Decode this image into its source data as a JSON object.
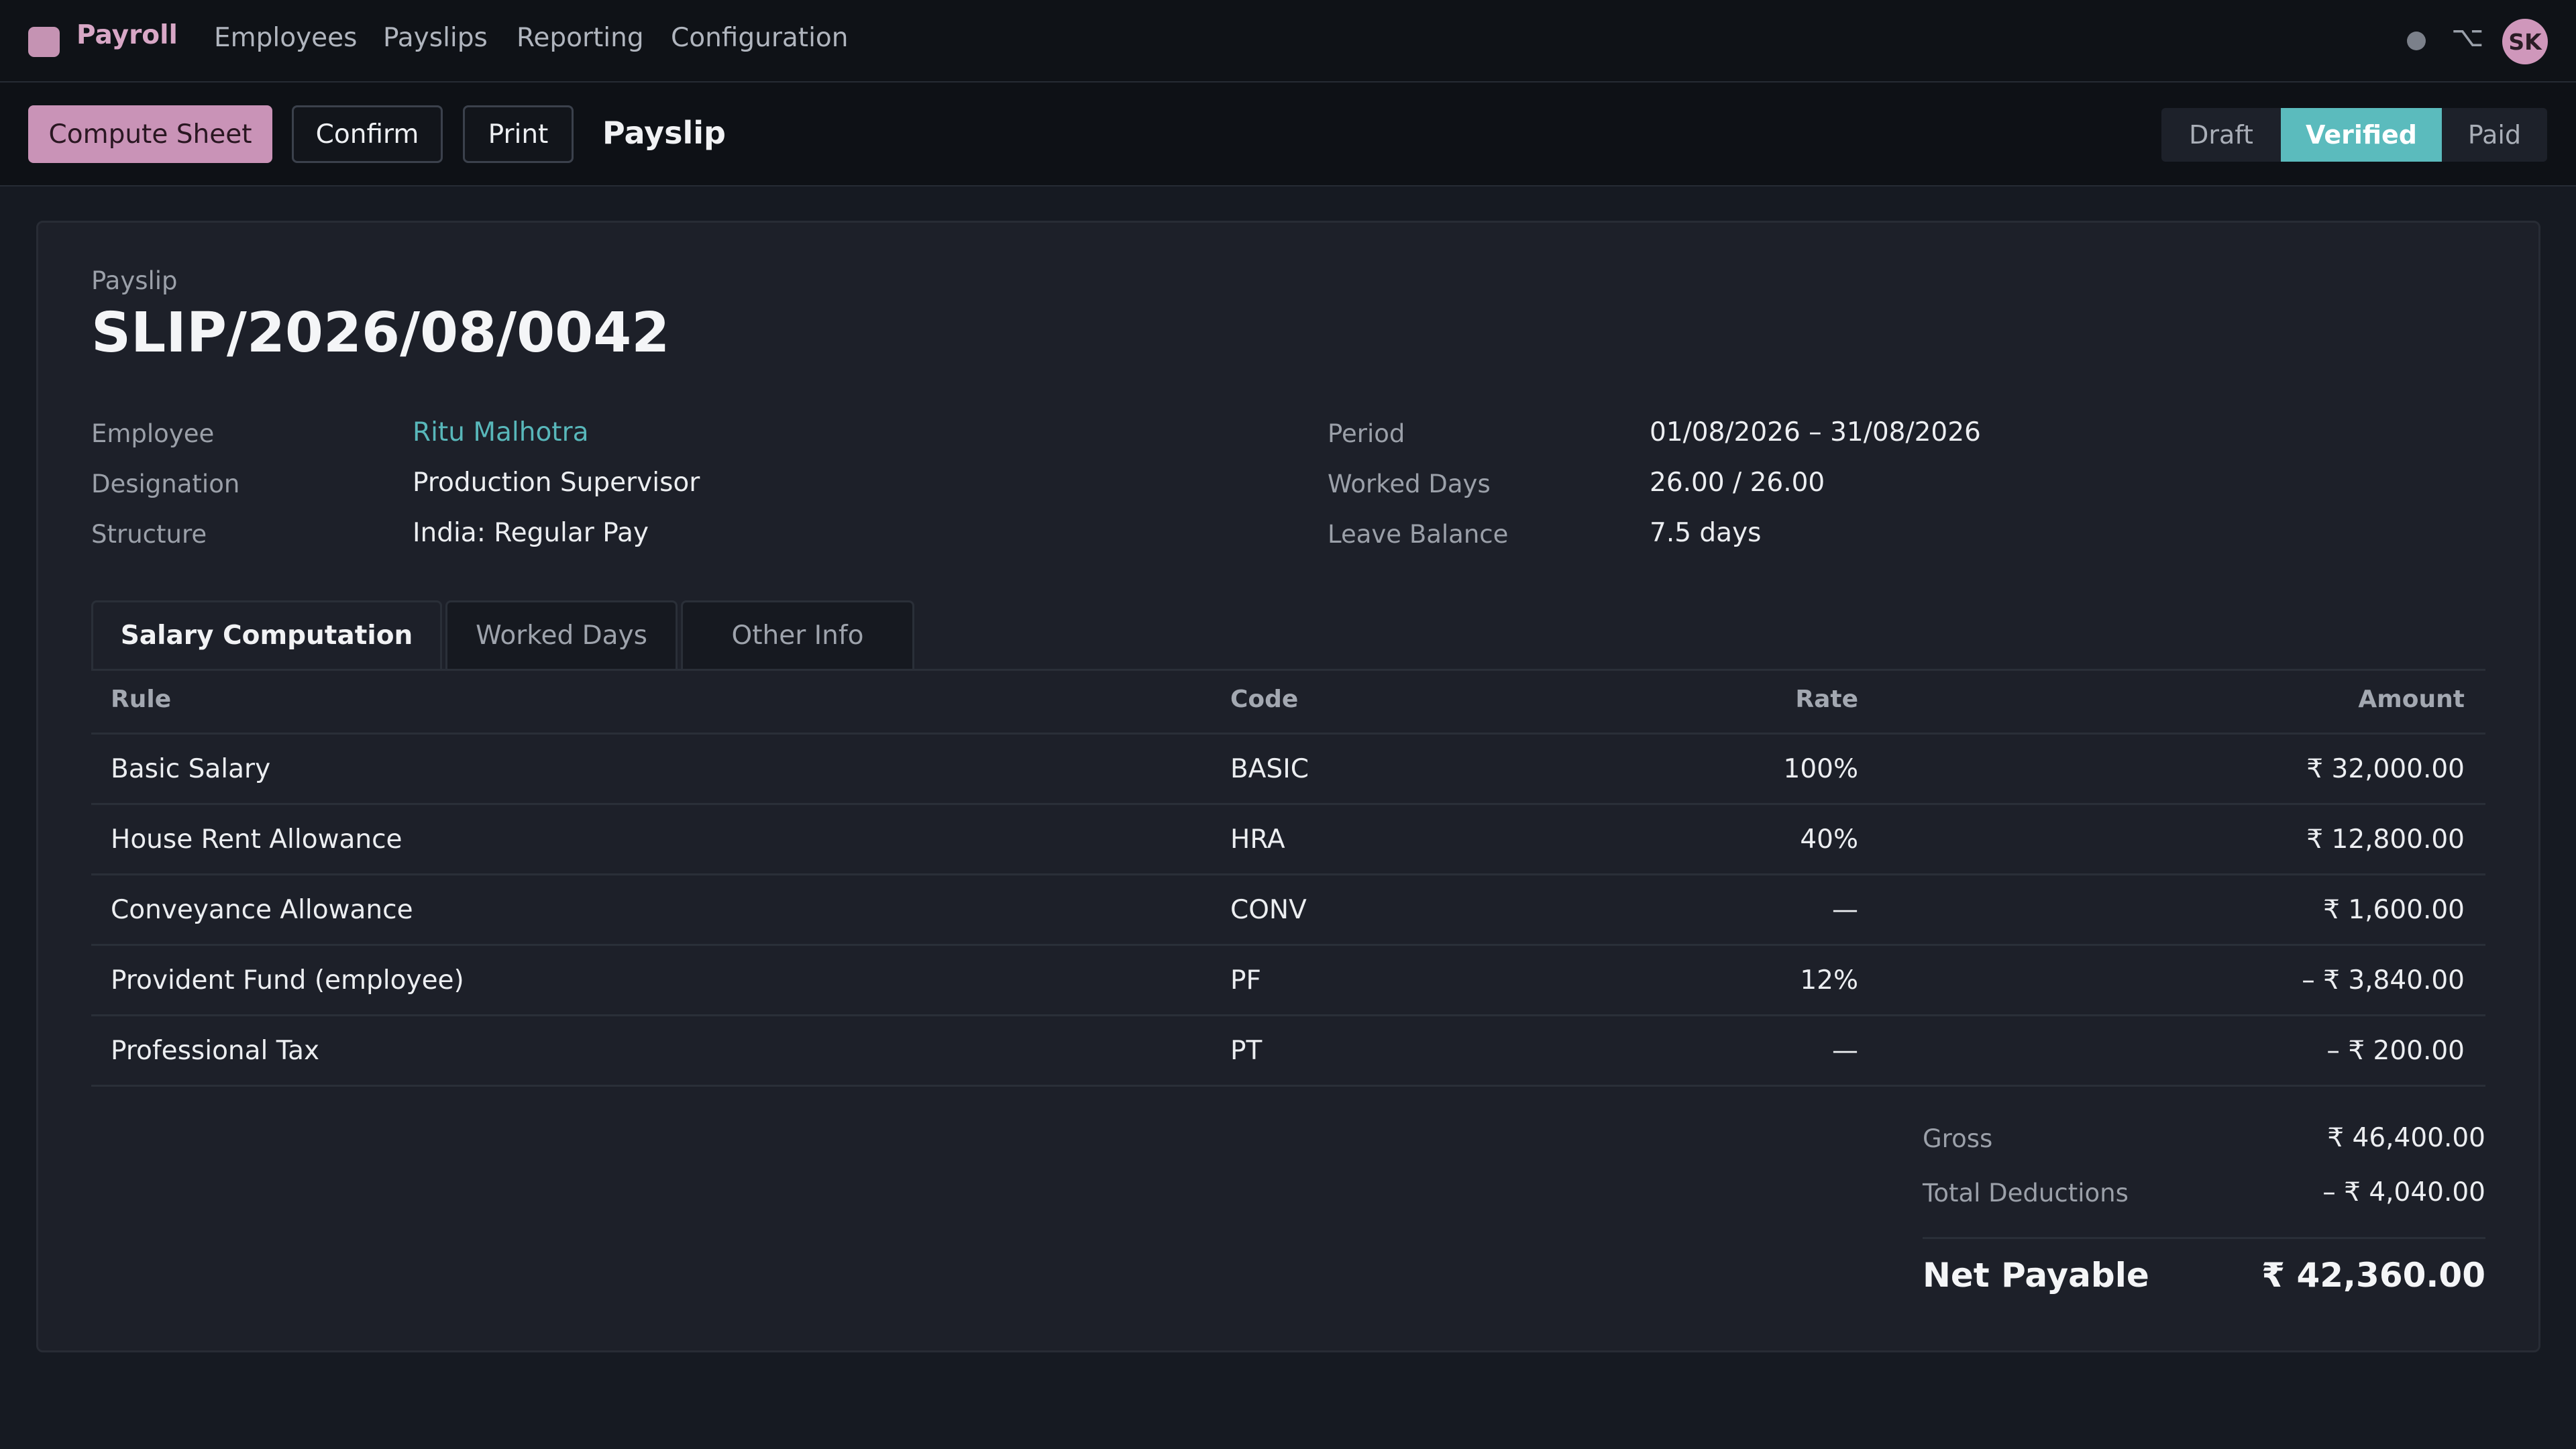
{
  "topbar": {
    "app_name": "Payroll",
    "nav": [
      "Employees",
      "Payslips",
      "Reporting",
      "Configuration"
    ],
    "avatar_initials": "SK",
    "switch_glyph": "⌥"
  },
  "actions": {
    "compute_label": "Compute Sheet",
    "confirm_label": "Confirm",
    "print_label": "Print",
    "title": "Payslip"
  },
  "status": {
    "steps": [
      "Draft",
      "Verified",
      "Paid"
    ],
    "active": "Verified"
  },
  "slip": {
    "eyebrow": "Payslip",
    "number": "SLIP/2026/08/0042"
  },
  "details": {
    "left": [
      {
        "label": "Employee",
        "value": "Ritu Malhotra"
      },
      {
        "label": "Designation",
        "value": "Production Supervisor"
      },
      {
        "label": "Structure",
        "value": "India: Regular Pay"
      }
    ],
    "right": [
      {
        "label": "Period",
        "value": "01/08/2026 – 31/08/2026"
      },
      {
        "label": "Worked Days",
        "value": "26.00 / 26.00"
      },
      {
        "label": "Leave Balance",
        "value": "7.5 days"
      }
    ]
  },
  "tabs": [
    "Salary Computation",
    "Worked Days",
    "Other Info"
  ],
  "table": {
    "headers": {
      "rule": "Rule",
      "code": "Code",
      "rate": "Rate",
      "amount": "Amount"
    },
    "rows": [
      {
        "rule": "Basic Salary",
        "code": "BASIC",
        "rate": "100%",
        "amount": "₹ 32,000.00"
      },
      {
        "rule": "House Rent Allowance",
        "code": "HRA",
        "rate": "40%",
        "amount": "₹ 12,800.00"
      },
      {
        "rule": "Conveyance Allowance",
        "code": "CONV",
        "rate": "—",
        "amount": "₹ 1,600.00"
      },
      {
        "rule": "Provident Fund (employee)",
        "code": "PF",
        "rate": "12%",
        "amount": "– ₹ 3,840.00"
      },
      {
        "rule": "Professional Tax",
        "code": "PT",
        "rate": "—",
        "amount": "– ₹ 200.00"
      }
    ]
  },
  "summary": {
    "gross_label": "Gross",
    "gross_value": "₹ 46,400.00",
    "deductions_label": "Total Deductions",
    "deductions_value": "– ₹ 4,040.00",
    "net_label": "Net Payable",
    "net_value": "₹ 42,360.00"
  },
  "colors": {
    "accent_pink": "#c993b7",
    "accent_teal": "#5bbbbd",
    "background": "#161a22"
  }
}
